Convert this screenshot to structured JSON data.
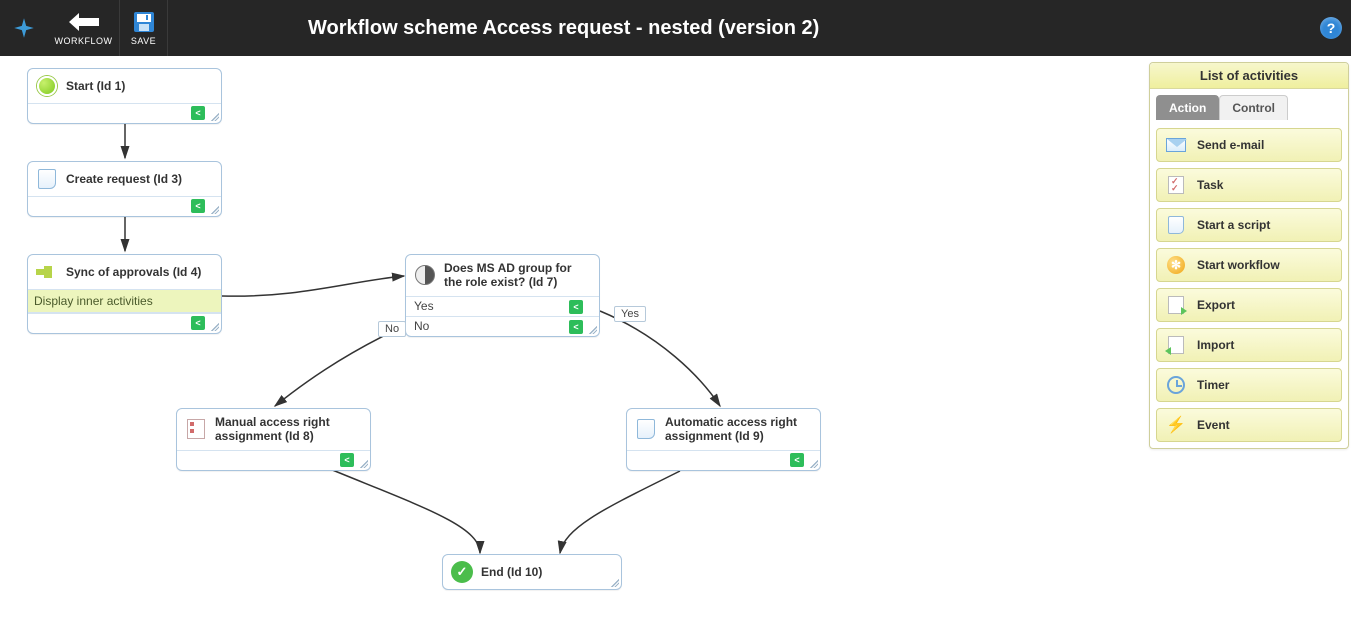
{
  "toolbar": {
    "workflow_label": "WORKFLOW",
    "save_label": "SAVE"
  },
  "page_title": "Workflow scheme Access request - nested (version 2)",
  "nodes": {
    "start": {
      "title": "Start (Id 1)"
    },
    "create": {
      "title": "Create request (Id 3)"
    },
    "sync": {
      "title": "Sync of approvals (Id 4)",
      "inner": "Display inner activities"
    },
    "decide": {
      "title": "Does MS AD group for the role exist? (Id 7)",
      "opt_yes": "Yes",
      "opt_no": "No"
    },
    "manual": {
      "title": "Manual access right assignment (Id 8)"
    },
    "auto": {
      "title": "Automatic access right assignment (Id 9)"
    },
    "end": {
      "title": "End (Id 10)"
    }
  },
  "edge_labels": {
    "yes": "Yes",
    "no": "No"
  },
  "sidebar": {
    "title": "List of activities",
    "tabs": {
      "action": "Action",
      "control": "Control"
    },
    "items": [
      {
        "key": "send-email",
        "label": "Send e-mail",
        "icon": "iic-mail"
      },
      {
        "key": "task",
        "label": "Task",
        "icon": "iic-task"
      },
      {
        "key": "start-script",
        "label": "Start a script",
        "icon": "iic-script"
      },
      {
        "key": "start-workflow",
        "label": "Start workflow",
        "icon": "iic-wf"
      },
      {
        "key": "export",
        "label": "Export",
        "icon": "iic-exp"
      },
      {
        "key": "import",
        "label": "Import",
        "icon": "iic-imp"
      },
      {
        "key": "timer",
        "label": "Timer",
        "icon": "iic-timer"
      },
      {
        "key": "event",
        "label": "Event",
        "icon": "iic-event"
      }
    ]
  }
}
